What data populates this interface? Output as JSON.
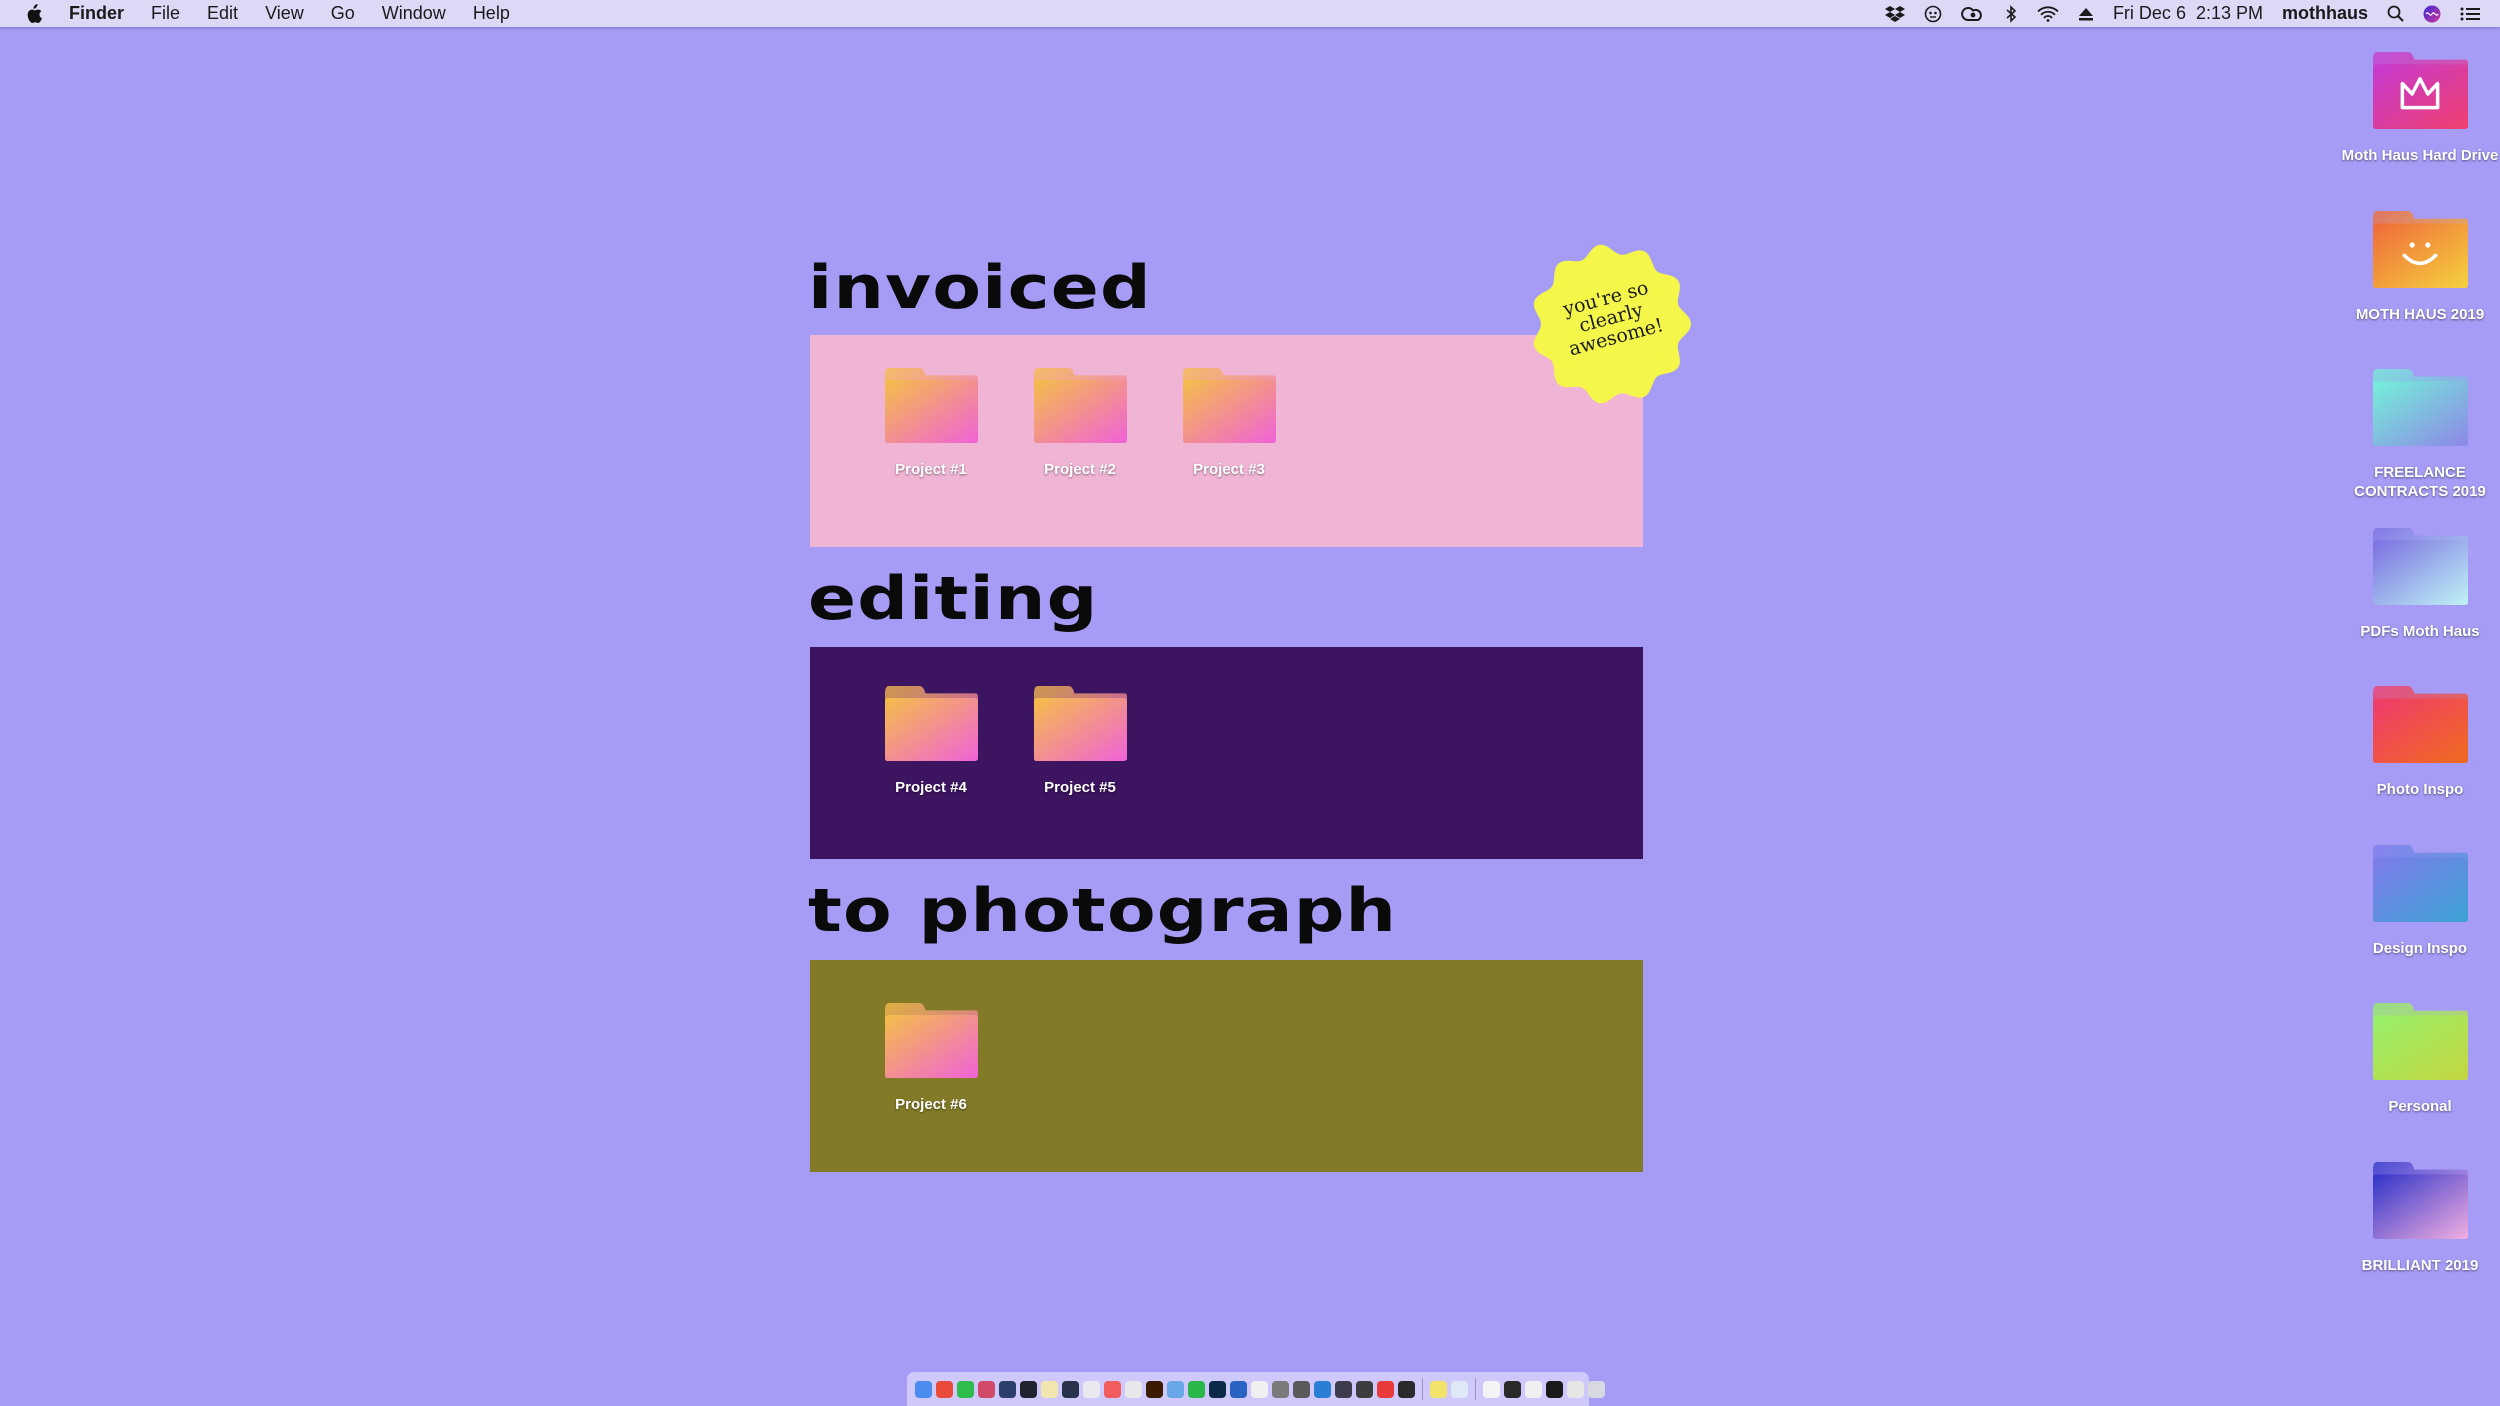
{
  "menubar": {
    "app": "Finder",
    "menus": [
      "File",
      "Edit",
      "View",
      "Go",
      "Window",
      "Help"
    ],
    "status_icons": [
      "dropbox-icon",
      "alfred-icon",
      "creative-cloud-icon",
      "bluetooth-icon",
      "wifi-icon",
      "eject-icon"
    ],
    "datetime": "Fri Dec 6  2:13 PM",
    "user": "mothhaus"
  },
  "board": {
    "sections": [
      {
        "title": "invoiced",
        "folders": [
          "Project #1",
          "Project #2",
          "Project #3"
        ]
      },
      {
        "title": "editing",
        "folders": [
          "Project #4",
          "Project #5"
        ]
      },
      {
        "title": "to photograph",
        "folders": [
          "Project #6"
        ]
      }
    ],
    "sticker": "you're so\nclearly\nawesome!"
  },
  "desktop_icons": [
    {
      "label": "Moth Haus Hard Drive",
      "icon": "crown-icon",
      "colors": [
        "#c53ad2",
        "#f0406e"
      ]
    },
    {
      "label": "MOTH HAUS 2019",
      "icon": "smiley-icon",
      "colors": [
        "#ef6a3a",
        "#f5d23e"
      ]
    },
    {
      "label": "FREELANCE CONTRACTS 2019",
      "icon": "folder-icon",
      "colors": [
        "#74f0d8",
        "#8d87e6"
      ]
    },
    {
      "label": "PDFs Moth Haus",
      "icon": "folder-icon",
      "colors": [
        "#7a6fe0",
        "#bff3f6"
      ]
    },
    {
      "label": "Photo Inspo",
      "icon": "folder-icon",
      "colors": [
        "#ef3b6e",
        "#f06b1e"
      ]
    },
    {
      "label": "Design Inspo",
      "icon": "folder-icon",
      "colors": [
        "#7f7ceb",
        "#3ba2d3"
      ]
    },
    {
      "label": "Personal",
      "icon": "folder-icon",
      "colors": [
        "#96f06a",
        "#c5d640"
      ]
    },
    {
      "label": "BRILLIANT 2019",
      "icon": "folder-icon",
      "colors": [
        "#2f34c8",
        "#f2aee1"
      ]
    }
  ],
  "project_folder_colors": [
    "#f5be48",
    "#f062d8"
  ],
  "dock_app_colors": [
    "#4a8cf0",
    "#e94a3a",
    "#2ebd4c",
    "#d14a6a",
    "#2c3e6a",
    "#1f2430",
    "#f2e6b0",
    "#28324a",
    "#e9e9ef",
    "#f25c5c",
    "#e8e8ea",
    "#3a1a00",
    "#67a7e8",
    "#2ab74a",
    "#0b2a4a",
    "#2a63c4",
    "#f0f0f0",
    "#7a7a7a",
    "#5a5a5a",
    "#2a7fd4",
    "#3c3c4c",
    "#3d3d3d",
    "#e83a3a",
    "#2a2a2a",
    "#f4e36a",
    "#dfe8f6",
    "#f4f4f4",
    "#2a2a2a",
    "#f0f0f0",
    "#1a1a1a",
    "#e6e6e6",
    "#d8d8e0"
  ]
}
